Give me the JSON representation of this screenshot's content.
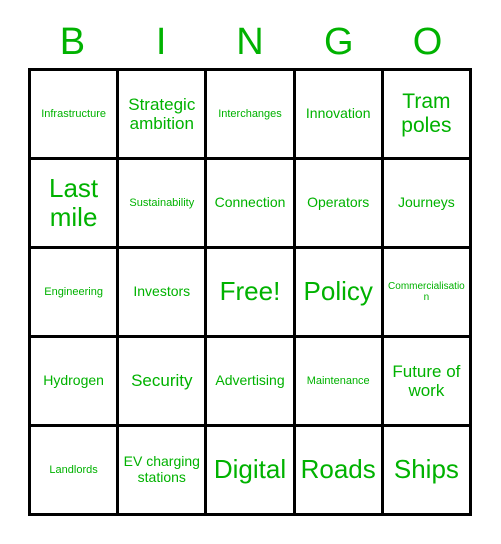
{
  "card": {
    "title": "BINGO",
    "accent_color": "#00b200",
    "grid_line_color": "#000000",
    "background_color": "#ffffff",
    "columns": 5,
    "rows": 5,
    "header_letters": [
      "B",
      "I",
      "N",
      "G",
      "O"
    ],
    "cells": [
      {
        "text": "Infrastructure",
        "size": "fs-sm",
        "free": false
      },
      {
        "text": "Strategic ambition",
        "size": "fs-lg",
        "free": false
      },
      {
        "text": "Interchanges",
        "size": "fs-sm",
        "free": false
      },
      {
        "text": "Innovation",
        "size": "fs-md",
        "free": false
      },
      {
        "text": "Tram poles",
        "size": "fs-xl",
        "free": false
      },
      {
        "text": "Last mile",
        "size": "fs-xxl",
        "free": false
      },
      {
        "text": "Sustainability",
        "size": "fs-sm",
        "free": false
      },
      {
        "text": "Connection",
        "size": "fs-md",
        "free": false
      },
      {
        "text": "Operators",
        "size": "fs-md",
        "free": false
      },
      {
        "text": "Journeys",
        "size": "fs-md",
        "free": false
      },
      {
        "text": "Engineering",
        "size": "fs-sm",
        "free": false
      },
      {
        "text": "Investors",
        "size": "fs-md",
        "free": false
      },
      {
        "text": "Free!",
        "size": "fs-xxl",
        "free": true
      },
      {
        "text": "Policy",
        "size": "fs-xxl",
        "free": false
      },
      {
        "text": "Commercialisation",
        "size": "fs-xs",
        "free": false
      },
      {
        "text": "Hydrogen",
        "size": "fs-md",
        "free": false
      },
      {
        "text": "Security",
        "size": "fs-lg",
        "free": false
      },
      {
        "text": "Advertising",
        "size": "fs-md",
        "free": false
      },
      {
        "text": "Maintenance",
        "size": "fs-sm",
        "free": false
      },
      {
        "text": "Future of work",
        "size": "fs-lg",
        "free": false
      },
      {
        "text": "Landlords",
        "size": "fs-sm",
        "free": false
      },
      {
        "text": "EV charging stations",
        "size": "fs-md",
        "free": false
      },
      {
        "text": "Digital",
        "size": "fs-xxl",
        "free": false
      },
      {
        "text": "Roads",
        "size": "fs-xxl",
        "free": false
      },
      {
        "text": "Ships",
        "size": "fs-xxl",
        "free": false
      }
    ]
  }
}
